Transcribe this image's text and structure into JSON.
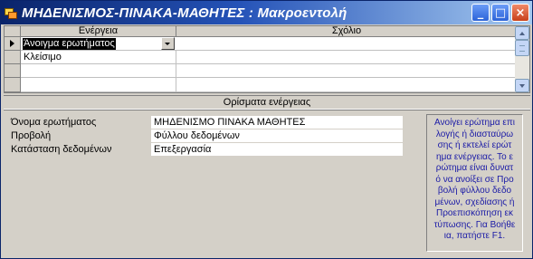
{
  "window": {
    "title": "ΜΗΔΕΝΙΣΜΟΣ-ΠΙΝΑΚΑ-ΜΑΘΗΤΕΣ : Μακροεντολή",
    "buttons": {
      "minimize": "_",
      "maximize": "□",
      "close": "×"
    }
  },
  "grid": {
    "columns": [
      "Ενέργεια",
      "Σχόλιο"
    ],
    "rows": [
      {
        "action": "Άνοιγμα ερωτήματος",
        "comment": ""
      },
      {
        "action": "Κλείσιμο",
        "comment": ""
      },
      {
        "action": "",
        "comment": ""
      },
      {
        "action": "",
        "comment": ""
      }
    ]
  },
  "arguments": {
    "header": "Ορίσματα ενέργειας",
    "fields": [
      {
        "label": "Όνομα ερωτήματος",
        "value": "ΜΗΔΕΝΙΣΜΟ ΠΙΝΑΚΑ ΜΑΘΗΤΕΣ"
      },
      {
        "label": "Προβολή",
        "value": "Φύλλου δεδομένων"
      },
      {
        "label": "Κατάσταση δεδομένων",
        "value": "Επεξεργασία"
      }
    ],
    "help": "Ανοίγει ερώτημα επι\nλογής ή διασταύρω\nσης ή εκτελεί ερώτ\nημα ενέργειας. Το ε\nρώτημα είναι δυνατ\nό να ανοίξει σε Προ\nβολή φύλλου δεδο\nμένων, σχεδίασης ή\nΠροεπισκόπηση εκ\nτύπωσης. Για Βοήθε\nια, πατήστε F1."
  },
  "colors": {
    "title_start": "#0a246a",
    "title_end": "#a6caf0",
    "help_text": "#1a1aa6"
  }
}
